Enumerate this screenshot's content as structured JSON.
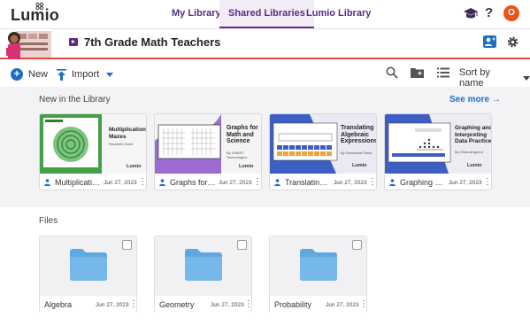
{
  "app": {
    "logo": "Lumio"
  },
  "nav": {
    "tabs": [
      {
        "label": "My Library",
        "active": false
      },
      {
        "label": "Shared Libraries",
        "active": true
      },
      {
        "label": "Lumio Library",
        "active": false
      }
    ],
    "help_glyph": "?",
    "avatar_initial": "O"
  },
  "header": {
    "title": "7th Grade Math Teachers"
  },
  "toolbar": {
    "new_label": "New",
    "import_label": "Import",
    "sort_label": "Sort by name"
  },
  "library": {
    "section_label": "New in the Library",
    "see_more_label": "See more",
    "cards": [
      {
        "name": "Multiplication Mazes",
        "date": "Jun 27, 2023",
        "thumb_title": "Multiplication Mazes",
        "thumb_sub": "Elizabeth Dodd",
        "thumb_brand": "Lumio",
        "accent": "#4caf50"
      },
      {
        "name": "Graphs for Math and Science",
        "date": "Jun 27, 2023",
        "thumb_title": "Graphs for Math and Science",
        "thumb_sub": "By SMART Technologies",
        "thumb_brand": "Lumio",
        "accent": "#8e5ac8"
      },
      {
        "name": "Translating Algebraic Expressions",
        "date": "Jun 27, 2023",
        "thumb_title": "Translating Algebraic Expressions",
        "thumb_sub": "By Samantha Parks",
        "thumb_brand": "Lumio",
        "accent": "#3a5fc8"
      },
      {
        "name": "Graphing and Interpreting Data Practice",
        "date": "Jun 27, 2023",
        "thumb_title": "Graphing and Interpreting Data Practice",
        "thumb_sub": "By Olivia Angrand",
        "thumb_brand": "Lumio",
        "accent": "#3a5fc8"
      }
    ]
  },
  "files": {
    "section_label": "Files",
    "items": [
      {
        "name": "Algebra",
        "date": "Jun 27, 2023"
      },
      {
        "name": "Geometry",
        "date": "Jun 27, 2023"
      },
      {
        "name": "Probability",
        "date": "Jun 27, 2023"
      }
    ]
  },
  "colors": {
    "brand_purple": "#5a2d82",
    "accent_blue": "#1f6ec2",
    "header_rule": "#e8483f",
    "folder_blue": "#69b3e7"
  },
  "icons": [
    "graduation-cap-icon",
    "help-icon",
    "share-user-icon",
    "gear-icon",
    "plus-icon",
    "import-icon",
    "search-icon",
    "new-folder-icon",
    "list-view-icon",
    "person-icon",
    "kebab-icon",
    "folder-icon",
    "arrow-right-icon"
  ]
}
